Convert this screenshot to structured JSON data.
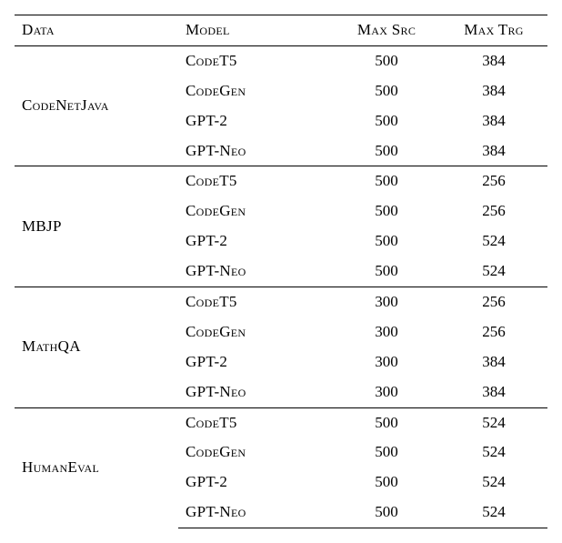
{
  "chart_data": {
    "type": "table",
    "headers": {
      "data": "Data",
      "model": "Model",
      "max_src": "Max Src",
      "max_trg": "Max Trg"
    },
    "groups": [
      {
        "data": "CodeNetJava",
        "rows": [
          {
            "model": "CodeT5",
            "max_src": 500,
            "max_trg": 384
          },
          {
            "model": "CodeGen",
            "max_src": 500,
            "max_trg": 384
          },
          {
            "model": "GPT-2",
            "max_src": 500,
            "max_trg": 384
          },
          {
            "model": "GPT-Neo",
            "max_src": 500,
            "max_trg": 384
          }
        ]
      },
      {
        "data": "MBJP",
        "rows": [
          {
            "model": "CodeT5",
            "max_src": 500,
            "max_trg": 256
          },
          {
            "model": "CodeGen",
            "max_src": 500,
            "max_trg": 256
          },
          {
            "model": "GPT-2",
            "max_src": 500,
            "max_trg": 524
          },
          {
            "model": "GPT-Neo",
            "max_src": 500,
            "max_trg": 524
          }
        ]
      },
      {
        "data": "MathQA",
        "rows": [
          {
            "model": "CodeT5",
            "max_src": 300,
            "max_trg": 256
          },
          {
            "model": "CodeGen",
            "max_src": 300,
            "max_trg": 256
          },
          {
            "model": "GPT-2",
            "max_src": 300,
            "max_trg": 384
          },
          {
            "model": "GPT-Neo",
            "max_src": 300,
            "max_trg": 384
          }
        ]
      },
      {
        "data": "HumanEval",
        "rows": [
          {
            "model": "CodeT5",
            "max_src": 500,
            "max_trg": 524
          },
          {
            "model": "CodeGen",
            "max_src": 500,
            "max_trg": 524
          },
          {
            "model": "GPT-2",
            "max_src": 500,
            "max_trg": 524
          },
          {
            "model": "GPT-Neo",
            "max_src": 500,
            "max_trg": 524
          }
        ]
      }
    ]
  }
}
